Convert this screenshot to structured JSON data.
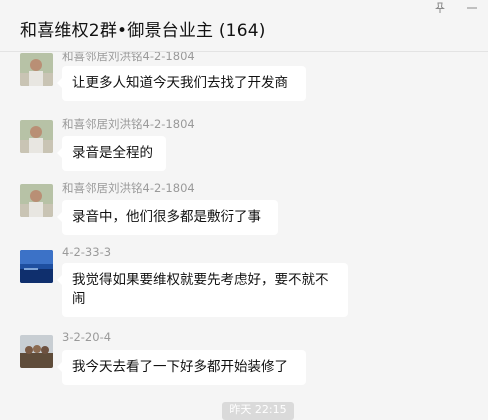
{
  "window": {
    "title": "和喜维权2群•御景台业主 (164)",
    "pin_icon": "pin-icon",
    "minimize_icon": "minimize-icon"
  },
  "messages": [
    {
      "sender": "和喜邻居刘洪铭4-2-1804",
      "text": "让更多人知道今天我们去找了开发商",
      "avatar": "avatar-man-outdoor"
    },
    {
      "sender": "和喜邻居刘洪铭4-2-1804",
      "text": "录音是全程的",
      "avatar": "avatar-man-outdoor"
    },
    {
      "sender": "和喜邻居刘洪铭4-2-1804",
      "text": "录音中，他们很多都是敷衍了事",
      "avatar": "avatar-man-outdoor"
    },
    {
      "sender": "4-2-33-3",
      "text": "我觉得如果要维权就要先考虑好，要不就不闹",
      "avatar": "avatar-sea-landscape"
    },
    {
      "sender": "3-2-20-4",
      "text": "我今天去看了一下好多都开始装修了",
      "avatar": "avatar-group-photo"
    }
  ],
  "time_divider": "昨天 22:15"
}
